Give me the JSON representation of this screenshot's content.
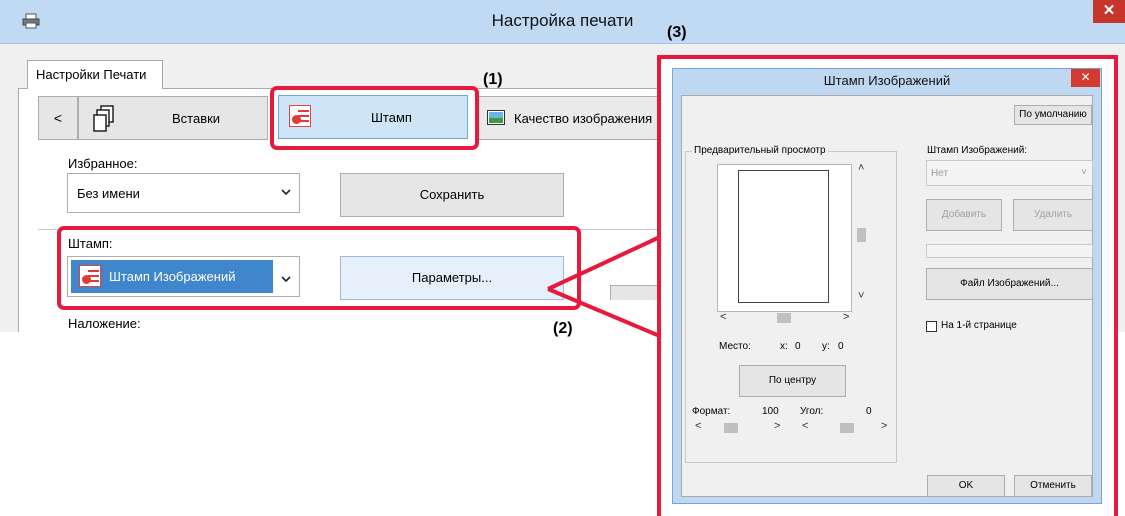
{
  "window": {
    "title": "Настройка печати",
    "close_glyph": "✕",
    "tab_label": "Настройки Печати"
  },
  "toolbar": {
    "prev_label": "<",
    "inserts_label": "Вставки",
    "stamp_label": "Штамп",
    "quality_label": "Качество изображения"
  },
  "favorites": {
    "label": "Избранное:",
    "value": "Без имени",
    "save_label": "Сохранить"
  },
  "stamp": {
    "label": "Штамп:",
    "value": "Штамп Изображений",
    "params_label": "Параметры..."
  },
  "overlay": {
    "label": "Наложение:"
  },
  "callouts": {
    "c1": "(1)",
    "c2": "(2)",
    "c3": "(3)"
  },
  "dialog": {
    "title": "Штамп Изображений",
    "close_glyph": "✕",
    "default_label": "По умолчанию",
    "preview_caption": "Предварительный просмотр",
    "stamp_dd_label": "Штамп Изображений:",
    "stamp_dd_value": "Нет",
    "add_label": "Добавить",
    "delete_label": "Удалить",
    "file_label": "Файл Изображений...",
    "first_page_label": "На 1-й странице",
    "place_label": "Место:",
    "x_label": "x:",
    "x_value": "0",
    "y_label": "y:",
    "y_value": "0",
    "center_label": "По центру",
    "format_label": "Формат:",
    "format_value": "100",
    "angle_label": "Угол:",
    "angle_value": "0",
    "ok_label": "OK",
    "cancel_label": "Отменить"
  },
  "colors": {
    "highlight": "#e8193c",
    "title_bar": "#c0daf4",
    "selection": "#3f86cc",
    "close": "#c7362b"
  },
  "icons": {
    "app": "printer-icon",
    "inserts": "pages-icon",
    "stamp": "stamp-icon",
    "quality": "image-icon",
    "dropdown": "chevron-down-icon"
  }
}
